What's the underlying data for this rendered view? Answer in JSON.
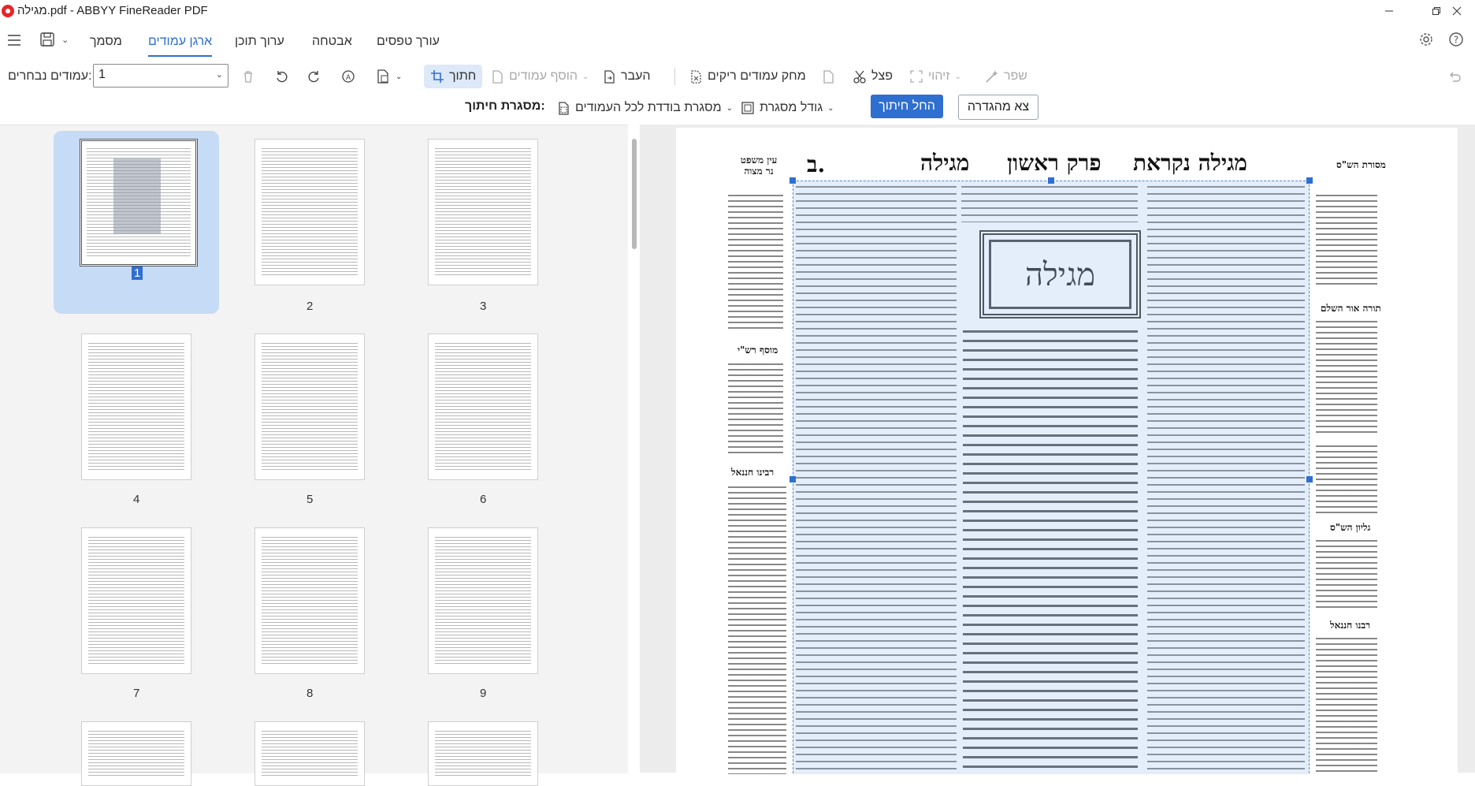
{
  "window": {
    "title": "מגילה.pdf - ABBYY FineReader PDF"
  },
  "menu": {
    "items": [
      "עורך טפסים",
      "אבטחה",
      "ערוך תוכן",
      "ארגן עמודים",
      "מסמך"
    ],
    "active": "ארגן עמודים"
  },
  "toolbar": {
    "improve": "שפר",
    "recognize": "זיהוי",
    "split": "פצל",
    "delete_blank": "מחק עמודים ריקים",
    "move": "העבר",
    "add_pages": "הוסף עמודים",
    "crop": "חתוך",
    "selected_pages_label": "עמודים נבחרים:",
    "selected_pages_value": "1"
  },
  "cropbar": {
    "exit": "צא מהגדרה",
    "start_crop": "החל חיתוך",
    "frame_size": "גודל מסגרת",
    "frame_all": "מסגרת בודדת לכל העמודים",
    "crop_frame_label": "מסגרת חיתוך:"
  },
  "thumbnails": {
    "pages": [
      "1",
      "2",
      "3",
      "4",
      "5",
      "6",
      "7",
      "8",
      "9"
    ],
    "selected": "1"
  },
  "document": {
    "header_right_label": "מסורת הש\"ס",
    "header_title_1": "מגילה נקראת",
    "header_title_2": "פרק ראשון",
    "header_title_3": "מגילה",
    "header_folio": "ב.",
    "header_left_label_1": "עין משפט",
    "header_left_label_2": "נר מצוה",
    "center_title": "מגילה",
    "sections": [
      "תורה אור השלם",
      "גליון הש\"ס",
      "רבנו חננאל",
      "מוסף רש\"י",
      "רבינו חננאל"
    ]
  },
  "colors": {
    "accent": "#2f6fd0",
    "selection": "#c6dbf5"
  }
}
